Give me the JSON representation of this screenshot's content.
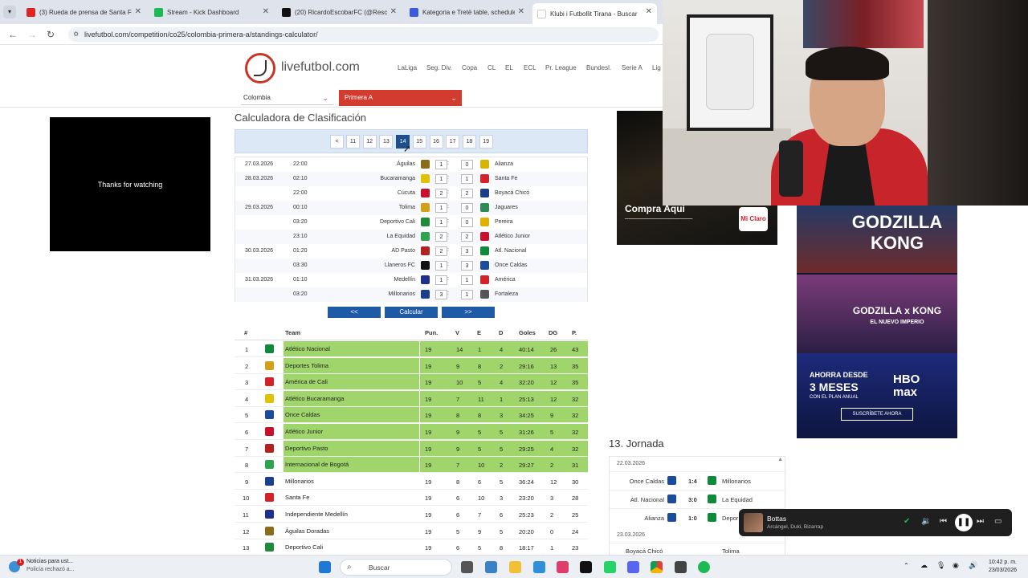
{
  "browser": {
    "tabs": [
      {
        "title": "(3) Rueda de prensa de Santa F",
        "color": "#e02424",
        "active": false
      },
      {
        "title": "Stream - Kick Dashboard",
        "color": "#1db954",
        "active": false
      },
      {
        "title": "(20) RicardoEscobarFC (@Rescob",
        "color": "#111111",
        "active": false
      },
      {
        "title": "Kategoria e Tretë table, schedule",
        "color": "#3b5bdb",
        "active": false
      },
      {
        "title": "Klubi i Futbollit Tirana - Buscar",
        "color": "#ffffff",
        "active": true
      }
    ],
    "url": "livefutbol.com/competition/co25/colombia-primera-a/standings-calculator/"
  },
  "site": {
    "logo_text": "livefutbol.com",
    "nav": [
      "LaLiga",
      "Seg. Div.",
      "Copa",
      "CL",
      "EL",
      "ECL",
      "Pr. League",
      "Bundesl.",
      "Serie A",
      "Lig"
    ],
    "country_select": "Colombia",
    "league_select": "Primera A"
  },
  "video": {
    "text": "Thanks for watching"
  },
  "calculator": {
    "title": "Calculadora de Clasificación",
    "prev": "<",
    "rounds": [
      "11",
      "12",
      "13",
      "14",
      "15",
      "16",
      "17",
      "18",
      "19"
    ],
    "selected_round": "14",
    "matches": [
      {
        "date": "27.03.2026",
        "time": "22:00",
        "home": "Águilas",
        "hs": "1",
        "as": "0",
        "away": "Alianza",
        "hc": "#8a6d1a",
        "ac": "#d8b400"
      },
      {
        "date": "28.03.2026",
        "time": "02:10",
        "home": "Bucaramanga",
        "hs": "1",
        "as": "1",
        "away": "Santa Fe",
        "hc": "#e1c200",
        "ac": "#d3222a"
      },
      {
        "date": "",
        "time": "22:00",
        "home": "Cúcuta",
        "hs": "2",
        "as": "2",
        "away": "Boyacá Chicó",
        "hc": "#c8102e",
        "ac": "#1b3f8b"
      },
      {
        "date": "29.03.2026",
        "time": "00:10",
        "home": "Tolima",
        "hs": "1",
        "as": "0",
        "away": "Jaguares",
        "hc": "#d4a017",
        "ac": "#2e8b57"
      },
      {
        "date": "",
        "time": "03:20",
        "home": "Deportivo Cali",
        "hs": "1",
        "as": "0",
        "away": "Pereira",
        "hc": "#1e8a3a",
        "ac": "#e0b000"
      },
      {
        "date": "",
        "time": "23:10",
        "home": "La Equidad",
        "hs": "2",
        "as": "2",
        "away": "Atlético Junior",
        "hc": "#2fa44f",
        "ac": "#c8102e"
      },
      {
        "date": "30.03.2026",
        "time": "01:20",
        "home": "AD Pasto",
        "hs": "2",
        "as": "3",
        "away": "Atl. Nacional",
        "hc": "#b22222",
        "ac": "#0f8a3a"
      },
      {
        "date": "",
        "time": "03:30",
        "home": "Llaneros FC",
        "hs": "1",
        "as": "3",
        "away": "Once Caldas",
        "hc": "#111111",
        "ac": "#1b4b9b"
      },
      {
        "date": "31.03.2026",
        "time": "01:10",
        "home": "Medellín",
        "hs": "1",
        "as": "1",
        "away": "América",
        "hc": "#1e2f8c",
        "ac": "#d3222a"
      },
      {
        "date": "",
        "time": "03:20",
        "home": "Millonarios",
        "hs": "3",
        "as": "1",
        "away": "Fortaleza",
        "hc": "#1b3f8b",
        "ac": "#555555"
      }
    ],
    "btn_prev": "<<",
    "btn_calc": "Calcular",
    "btn_next": ">>"
  },
  "standings": {
    "headers": {
      "pos": "#",
      "team": "Team",
      "pun": "Pun.",
      "v": "V",
      "e": "E",
      "d": "D",
      "goles": "Goles",
      "dg": "DG",
      "p": "P."
    },
    "rows": [
      {
        "pos": "1",
        "team": "Atlético Nacional",
        "pun": "19",
        "v": "14",
        "e": "1",
        "d": "4",
        "goles": "40:14",
        "dg": "26",
        "p": "43",
        "c": "#0f8a3a",
        "green": true
      },
      {
        "pos": "2",
        "team": "Deportes Tolima",
        "pun": "19",
        "v": "9",
        "e": "8",
        "d": "2",
        "goles": "29:16",
        "dg": "13",
        "p": "35",
        "c": "#d4a017",
        "green": true
      },
      {
        "pos": "3",
        "team": "América de Cali",
        "pun": "19",
        "v": "10",
        "e": "5",
        "d": "4",
        "goles": "32:20",
        "dg": "12",
        "p": "35",
        "c": "#d3222a",
        "green": true
      },
      {
        "pos": "4",
        "team": "Atlético Bucaramanga",
        "pun": "19",
        "v": "7",
        "e": "11",
        "d": "1",
        "goles": "25:13",
        "dg": "12",
        "p": "32",
        "c": "#e1c200",
        "green": true
      },
      {
        "pos": "5",
        "team": "Once Caldas",
        "pun": "19",
        "v": "8",
        "e": "8",
        "d": "3",
        "goles": "34:25",
        "dg": "9",
        "p": "32",
        "c": "#1b4b9b",
        "green": true
      },
      {
        "pos": "6",
        "team": "Atlético Junior",
        "pun": "19",
        "v": "9",
        "e": "5",
        "d": "5",
        "goles": "31:26",
        "dg": "5",
        "p": "32",
        "c": "#c8102e",
        "green": true
      },
      {
        "pos": "7",
        "team": "Deportivo Pasto",
        "pun": "19",
        "v": "9",
        "e": "5",
        "d": "5",
        "goles": "29:25",
        "dg": "4",
        "p": "32",
        "c": "#b22222",
        "green": true
      },
      {
        "pos": "8",
        "team": "Internacional de Bogotá",
        "pun": "19",
        "v": "7",
        "e": "10",
        "d": "2",
        "goles": "29:27",
        "dg": "2",
        "p": "31",
        "c": "#2fa44f",
        "green": true
      },
      {
        "pos": "9",
        "team": "Millonarios",
        "pun": "19",
        "v": "8",
        "e": "6",
        "d": "5",
        "goles": "36:24",
        "dg": "12",
        "p": "30",
        "c": "#1b3f8b",
        "green": false
      },
      {
        "pos": "10",
        "team": "Santa Fe",
        "pun": "19",
        "v": "6",
        "e": "10",
        "d": "3",
        "goles": "23:20",
        "dg": "3",
        "p": "28",
        "c": "#d3222a",
        "green": false
      },
      {
        "pos": "11",
        "team": "Independiente Medellín",
        "pun": "19",
        "v": "6",
        "e": "7",
        "d": "6",
        "goles": "25:23",
        "dg": "2",
        "p": "25",
        "c": "#1e2f8c",
        "green": false
      },
      {
        "pos": "12",
        "team": "Águilas Doradas",
        "pun": "19",
        "v": "5",
        "e": "9",
        "d": "5",
        "goles": "20:20",
        "dg": "0",
        "p": "24",
        "c": "#8a6d1a",
        "green": false
      },
      {
        "pos": "13",
        "team": "Deportivo Cali",
        "pun": "19",
        "v": "6",
        "e": "5",
        "d": "8",
        "goles": "18:17",
        "dg": "1",
        "p": "23",
        "c": "#1e8a3a",
        "green": false
      }
    ]
  },
  "ads": {
    "claro_cta": "Compra Aquí",
    "claro_brand": "Mi Claro",
    "movie1_title": "GODZILLA KONG",
    "movie2_title": "GODZILLA x KONG",
    "movie2_sub": "EL NUEVO IMPERIO",
    "hbo_line1": "AHORRA DESDE",
    "hbo_line2": "3 MESES",
    "hbo_line3": "CON EL PLAN ANUAL",
    "hbo_brand": "HBO max",
    "hbo_cta": "SUSCRÍBETE AHORA"
  },
  "jornada": {
    "title": "13. Jornada",
    "date1": "22.03.2026",
    "date2": "23.03.2026",
    "matches": [
      {
        "home": "Once Caldas",
        "score": "1:4",
        "away": "Millonarios"
      },
      {
        "home": "Atl. Nacional",
        "score": "3:0",
        "away": "La Equidad"
      },
      {
        "home": "Alianza",
        "score": "1:0",
        "away": "Depor"
      }
    ],
    "next_home": "Boyacá Chicó",
    "next_away": "Tolima"
  },
  "player": {
    "song": "Bottas",
    "artists": "Arcángel, Duki, Bizarrap"
  },
  "taskbar": {
    "news_title": "Noticias para ust...",
    "news_sub": "Policía rechazó a...",
    "search": "Buscar",
    "time": "10:42 p. m.",
    "date": "23/03/2026"
  }
}
